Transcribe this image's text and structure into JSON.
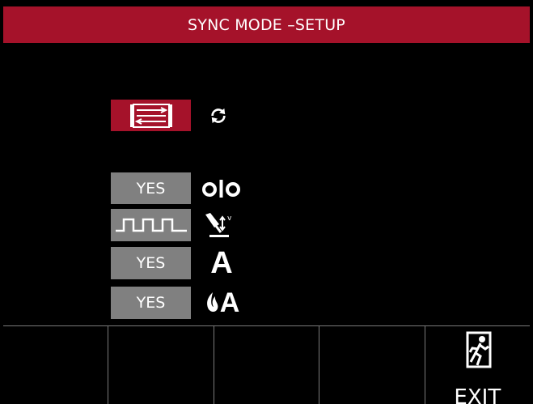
{
  "header": {
    "title": "SYNC MODE –SETUP",
    "color": "#a5122a"
  },
  "mode_selector": {
    "selected_icon": "sync-parallel-arrows-icon",
    "alternate_icon": "refresh-cycle-icon"
  },
  "settings": [
    {
      "value": "YES",
      "icon": "contact-open-close-icon"
    },
    {
      "value_icon": "pulse-waveform-icon",
      "icon": "wire-feed-voltage-icon"
    },
    {
      "value": "YES",
      "icon": "ampere-icon",
      "icon_text": "A"
    },
    {
      "value": "YES",
      "icon": "hot-start-ampere-icon",
      "icon_text": "A"
    }
  ],
  "softkeys": {
    "exit_label": "EXIT",
    "exit_icon": "running-man-exit-icon"
  },
  "colors": {
    "accent": "#a5122a",
    "value_box": "#808080",
    "background": "#000000"
  }
}
